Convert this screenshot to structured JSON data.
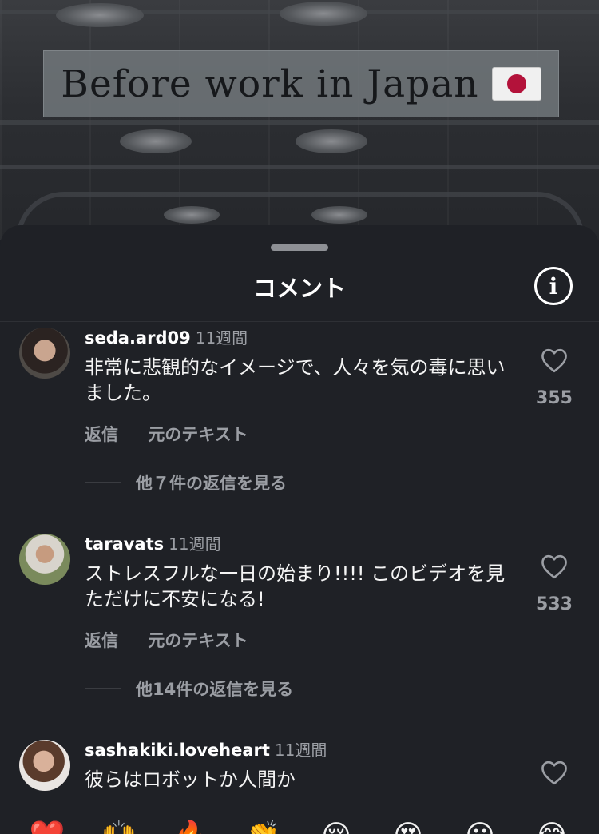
{
  "video": {
    "caption": "Before work in Japan",
    "caption_flag": "japan-flag-icon"
  },
  "sheet": {
    "title": "コメント",
    "info_icon": "info-icon"
  },
  "comments": [
    {
      "username": "seda.ard09",
      "age": "11週間",
      "text": "非常に悲観的なイメージで、人々を気の毒に思いました。",
      "reply_label": "返信",
      "original_text_label": "元のテキスト",
      "view_replies": "他７件の返信を見る",
      "likes": "355"
    },
    {
      "username": "taravats",
      "age": "11週間",
      "text": "ストレスフルな一日の始まり!!!! このビデオを見ただけに不安になる!",
      "reply_label": "返信",
      "original_text_label": "元のテキスト",
      "view_replies": "他14件の返信を見る",
      "likes": "533"
    },
    {
      "username": "sashakiki.loveheart",
      "age": "11週間",
      "text": "彼らはロボットか人間か"
    }
  ],
  "emoji_bar": [
    "❤️",
    "🙌",
    "🔥",
    "👏",
    "😢",
    "😍",
    "😮",
    "😂"
  ],
  "colors": {
    "sheet_background": "#1f2126",
    "secondary_text": "#9b9ea4",
    "primary_text": "#ffffff"
  }
}
